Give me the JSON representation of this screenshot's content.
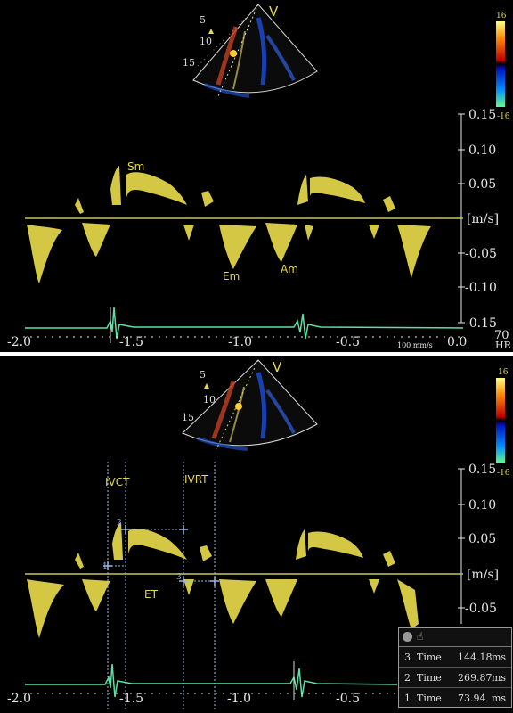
{
  "top": {
    "sector": {
      "depth_ticks": [
        "5",
        "10",
        "15"
      ],
      "mark": "V"
    },
    "colorbar": {
      "max": "16",
      "min": "-16"
    },
    "velocity_ticks": [
      "0.15",
      "0.10",
      "0.05",
      "[m/s]",
      "-0.05",
      "-0.10",
      "-0.15"
    ],
    "time_ticks": [
      "-2.0",
      "-1.5",
      "-1.0",
      "-0.5",
      "0.0"
    ],
    "sweep": "100 mm/s",
    "hr_value": "70",
    "hr_label": "HR",
    "waves": {
      "sm": "Sm",
      "em": "Em",
      "am": "Am"
    }
  },
  "bottom": {
    "sector": {
      "depth_ticks": [
        "5",
        "10",
        "15"
      ],
      "mark": "V"
    },
    "colorbar": {
      "max": "16",
      "min": "-16"
    },
    "velocity_ticks": [
      "0.15",
      "0.10",
      "0.05",
      "[m/s]",
      "-0.05"
    ],
    "time_ticks": [
      "-2.0",
      "-1.5",
      "-1.0",
      "-0.5"
    ],
    "intervals": {
      "ivct": "IVCT",
      "ivrt": "IVRT",
      "et": "ET"
    },
    "caliper_markers": [
      "2",
      "1",
      "3"
    ],
    "measurements": [
      {
        "index": "3",
        "label": "Time",
        "value": "144.18",
        "unit": "ms"
      },
      {
        "index": "2",
        "label": "Time",
        "value": "269.87",
        "unit": "ms"
      },
      {
        "index": "1",
        "label": "Time",
        "value": "73.94",
        "unit": "ms"
      }
    ]
  },
  "colors": {
    "doppler": "#e6d84a",
    "baseline": "#c9c45c",
    "ecg": "#5de0a6",
    "caliper": "#9ab8e8",
    "axis_text": "#e6e6e6"
  }
}
